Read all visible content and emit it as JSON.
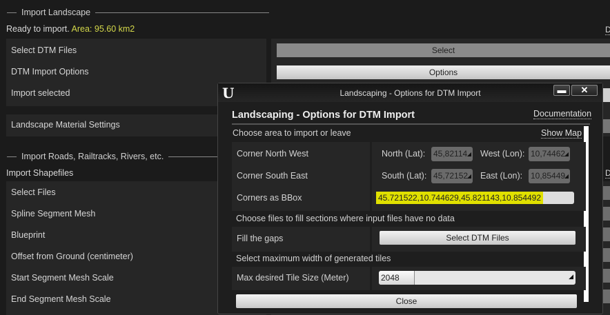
{
  "landscape": {
    "section_title": "Import Landscape",
    "status": "Ready to import.",
    "area": "Area: 95.60 km2",
    "rows": [
      "Select DTM Files",
      "DTM Import Options",
      "Import selected"
    ],
    "material": "Landscape Material Settings",
    "select_button": "Select",
    "options_button": "Options",
    "doc_link_short": "D"
  },
  "roads": {
    "section_title": "Import Roads, Railtracks, Rivers, etc.",
    "subtitle": "Import Shapefiles",
    "rows": [
      "Select Files",
      "Spline Segment Mesh",
      "Blueprint",
      "Offset from Ground (centimeter)",
      "Start Segment Mesh Scale",
      "End Segment Mesh Scale"
    ],
    "doc_link_short": "D"
  },
  "dialog": {
    "window_title": "Landscaping - Options for DTM Import",
    "heading": "Landscaping - Options for DTM Import",
    "documentation": "Documentation",
    "choose_area": "Choose area to import or leave",
    "show_map": "Show Map",
    "nw_label": "Corner North West",
    "se_label": "Corner South East",
    "bbox_label": "Corners as BBox",
    "north_label": "North (Lat):",
    "north_value": "45,82114",
    "west_label": "West (Lon):",
    "west_value": "10,74462",
    "south_label": "South (Lat):",
    "south_value": "45,72152",
    "east_label": "East (Lon):",
    "east_value": "10,85449",
    "bbox_value": "45.721522,10.744629,45.821143,10.854492",
    "fill_hint": "Choose files to fill sections where input files have no data",
    "fill_label": "Fill the gaps",
    "fill_button": "Select DTM Files",
    "tile_hint": "Select maximum width of generated tiles",
    "tile_label": "Max desired Tile Size (Meter)",
    "tile_value": "2048",
    "close_button": "Close",
    "minimize": "▬",
    "close_x": "✕"
  },
  "colors": {
    "highlight": "#e0e000",
    "area_text": "#d4d84a"
  }
}
